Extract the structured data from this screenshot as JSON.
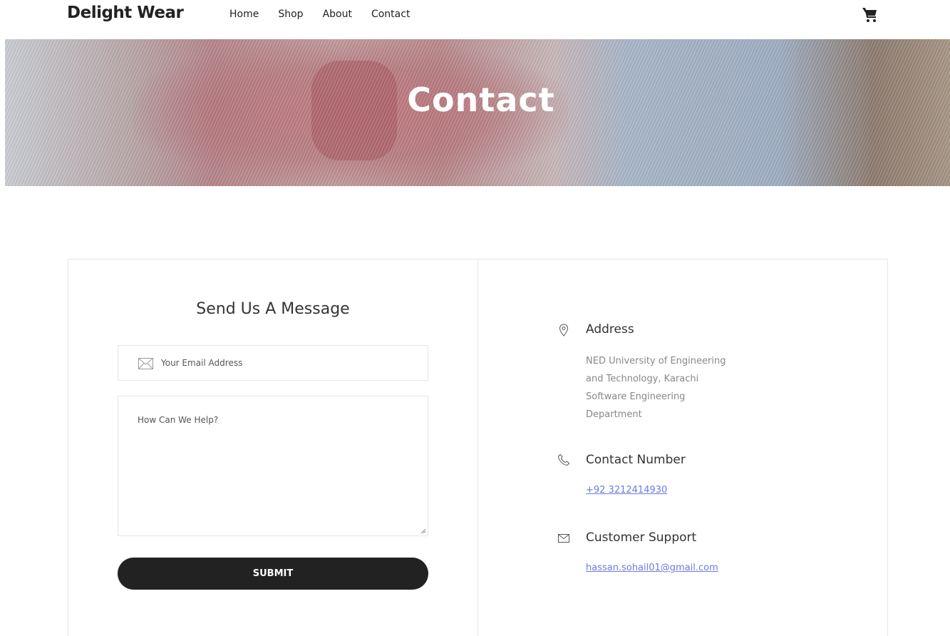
{
  "header": {
    "brand": "Delight Wear",
    "nav": [
      "Home",
      "Shop",
      "About",
      "Contact"
    ],
    "cart_icon": "shopping-cart-icon"
  },
  "hero": {
    "title": "Contact"
  },
  "form": {
    "title": "Send Us A Message",
    "email_placeholder": "Your Email Address",
    "email_icon": "envelope-icon",
    "message_placeholder": "How Can We Help?",
    "submit_label": "SUBMIT"
  },
  "info": {
    "address": {
      "icon": "map-pin-icon",
      "heading": "Address",
      "lines": [
        "NED University of Engineering",
        "and Technology, Karachi",
        "Software Engineering",
        "Department"
      ]
    },
    "phone": {
      "icon": "phone-icon",
      "heading": "Contact Number",
      "value": "+92 3212414930"
    },
    "support": {
      "icon": "envelope-icon",
      "heading": "Customer Support",
      "value": "hassan.sohail01@gmail.com"
    }
  },
  "colors": {
    "link": "#6c7ae0",
    "button": "#222222",
    "border": "#e6e6e6"
  }
}
